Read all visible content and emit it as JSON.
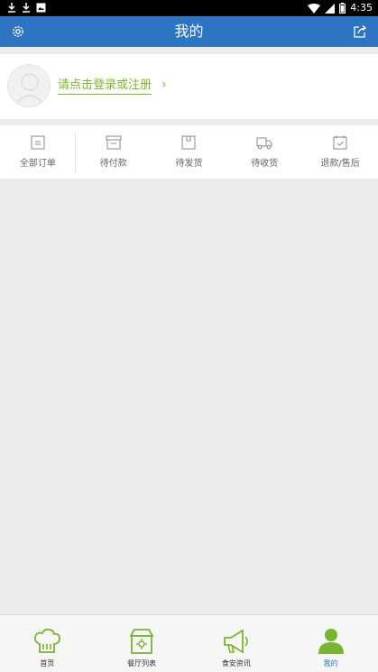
{
  "status_bar": {
    "time": "4:35"
  },
  "header": {
    "title": "我的"
  },
  "login": {
    "prompt": "请点击登录或注册",
    "chevron": "›"
  },
  "orders": [
    {
      "label": "全部订单"
    },
    {
      "label": "待付款"
    },
    {
      "label": "待发货"
    },
    {
      "label": "待收货"
    },
    {
      "label": "退款/售后"
    }
  ],
  "bottom_nav": [
    {
      "label": "首页"
    },
    {
      "label": "餐厅列表"
    },
    {
      "label": "食安资讯"
    },
    {
      "label": "我的"
    }
  ],
  "colors": {
    "primary": "#2d74c3",
    "accent": "#79b829",
    "nav_icon": "#7ab52f"
  }
}
